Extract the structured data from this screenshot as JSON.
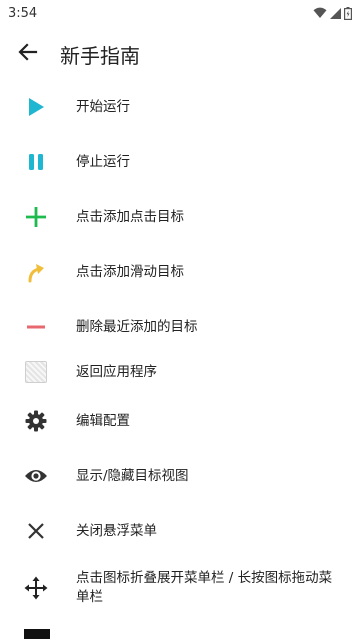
{
  "status_bar": {
    "time": "3:54"
  },
  "header": {
    "title": "新手指南"
  },
  "items": [
    {
      "icon": "play-icon",
      "label": "开始运行",
      "color": "#1FB6D1"
    },
    {
      "icon": "pause-icon",
      "label": "停止运行",
      "color": "#1FB6D1"
    },
    {
      "icon": "plus-icon",
      "label": "点击添加点击目标",
      "color": "#1DBB4E"
    },
    {
      "icon": "swipe-arrow-icon",
      "label": "点击添加滑动目标",
      "color": "#F2BE3A"
    },
    {
      "icon": "minus-icon",
      "label": "删除最近添加的目标",
      "color": "#E8686F"
    },
    {
      "icon": "app-thumbnail-icon",
      "label": "返回应用程序"
    },
    {
      "icon": "gear-icon",
      "label": "编辑配置",
      "color": "#333333"
    },
    {
      "icon": "eye-icon",
      "label": "显示/隐藏目标视图",
      "color": "#333333"
    },
    {
      "icon": "close-icon",
      "label": "关闭悬浮菜单",
      "color": "#333333"
    },
    {
      "icon": "move-arrows-icon",
      "label": "点击图标折叠展开菜单栏 / 长按图标拖动菜单栏",
      "color": "#222222"
    }
  ]
}
